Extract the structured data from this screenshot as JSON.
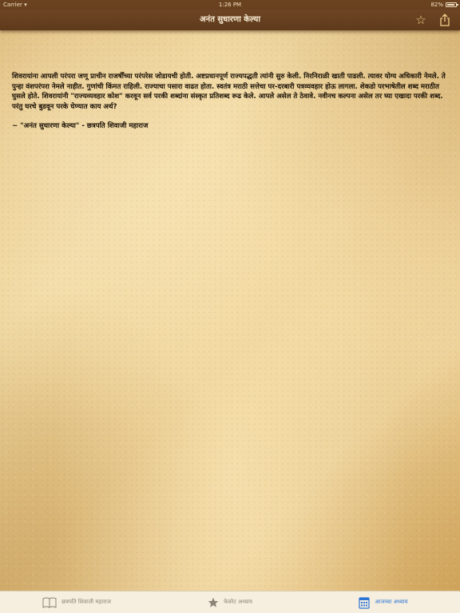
{
  "status_bar": {
    "carrier": "Carrier",
    "time": "1:26 PM",
    "battery": "82%"
  },
  "nav": {
    "title": "अनंत सुधारणा केल्या",
    "star_icon": "star-outline-icon",
    "share_icon": "share-icon"
  },
  "content": {
    "paragraph": "शिवरायांना आपली परंपरा जणू प्राचीन राजर्षींच्या परंपरेस जोडायची होती. अष्टप्रधानपूर्ण राज्यपद्धती त्यांनी सुरु केली. निरनिराळी खाती पाडली. त्यावर योग्य अधिकारी नेमले. ते पुन्हा वंशपरंपरा नेमले नाहीत. गुणांची किंमत राहिली. राज्याचा पसारा वाढत होता. स्वतंत्र मराठी सत्तेचा पर-दरबारी पत्रव्यवहार होऊ लागला. शेकडो परभाषेतील शब्द मराठीत घुसले होते. शिवरायांनी \"राज्यव्यवहार कोश\" करवून सर्व परकी शब्दांना संस्कृत प्रतिशब्द रूढ केले. आपले असेल ते ठेवावे. नवीनच कल्पना असेल तर घ्या एखादा परकी शब्द. परंतु घरचे बुडवून परके घेण्यात काय अर्थ?",
    "quote": "~ \"अनंत सुधारणा केल्या\" - छत्रपति शिवाजी महाराज"
  },
  "tabs": [
    {
      "label": "छत्रपति शिवाजी महाराज",
      "icon": "book-icon",
      "active": false
    },
    {
      "label": "फेवरेट अध्याय",
      "icon": "star-icon",
      "active": false
    },
    {
      "label": "आजच्या अध्याय",
      "icon": "calendar-icon",
      "active": true
    }
  ],
  "colors": {
    "nav_background": "#6e4524",
    "tab_active": "#2d74d6",
    "tab_inactive": "#8b8477"
  }
}
